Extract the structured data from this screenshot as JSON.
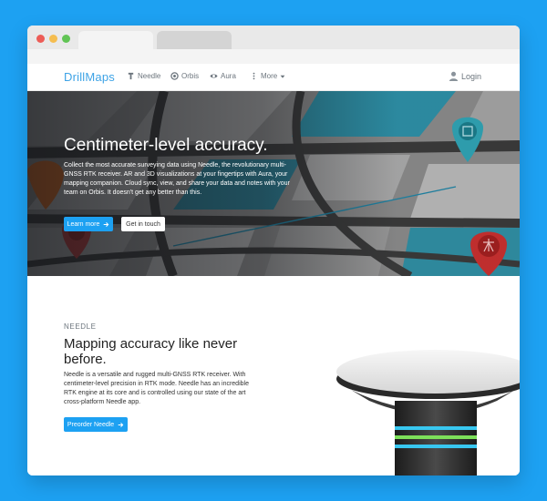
{
  "nav": {
    "brand": "DrillMaps",
    "items": [
      {
        "label": "Needle",
        "icon": "needle-icon"
      },
      {
        "label": "Orbis",
        "icon": "orbis-icon"
      },
      {
        "label": "Aura",
        "icon": "eye-icon"
      },
      {
        "label": "More",
        "icon": "more-vertical-icon"
      }
    ],
    "login": "Login"
  },
  "hero": {
    "title": "Centimeter-level accuracy.",
    "text": "Collect the most accurate surveying data using Needle, the revolutionary multi-GNSS RTK receiver. AR and 3D visualizations at your fingertips with Aura, your mapping companion. Cloud sync, view, and share your data and notes with your team on Orbis. It doesn't get any better than this.",
    "primary_button": "Learn more",
    "secondary_button": "Get in touch"
  },
  "needle": {
    "eyebrow": "NEEDLE",
    "title": "Mapping accuracy like never before.",
    "text": "Needle is a versatile and rugged multi-GNSS RTK receiver. With centimeter-level precision in RTK mode. Needle has an incredible RTK engine at its core and is controlled using our state of the art cross-platform Needle app.",
    "button": "Preorder Needle"
  },
  "colors": {
    "background": "#1da1f2",
    "accent": "#1da1f2",
    "brand": "#3da3e6",
    "pin_teal": "#2fa3b4",
    "pin_red": "#c8302f",
    "pin_orange": "#d5661f"
  }
}
